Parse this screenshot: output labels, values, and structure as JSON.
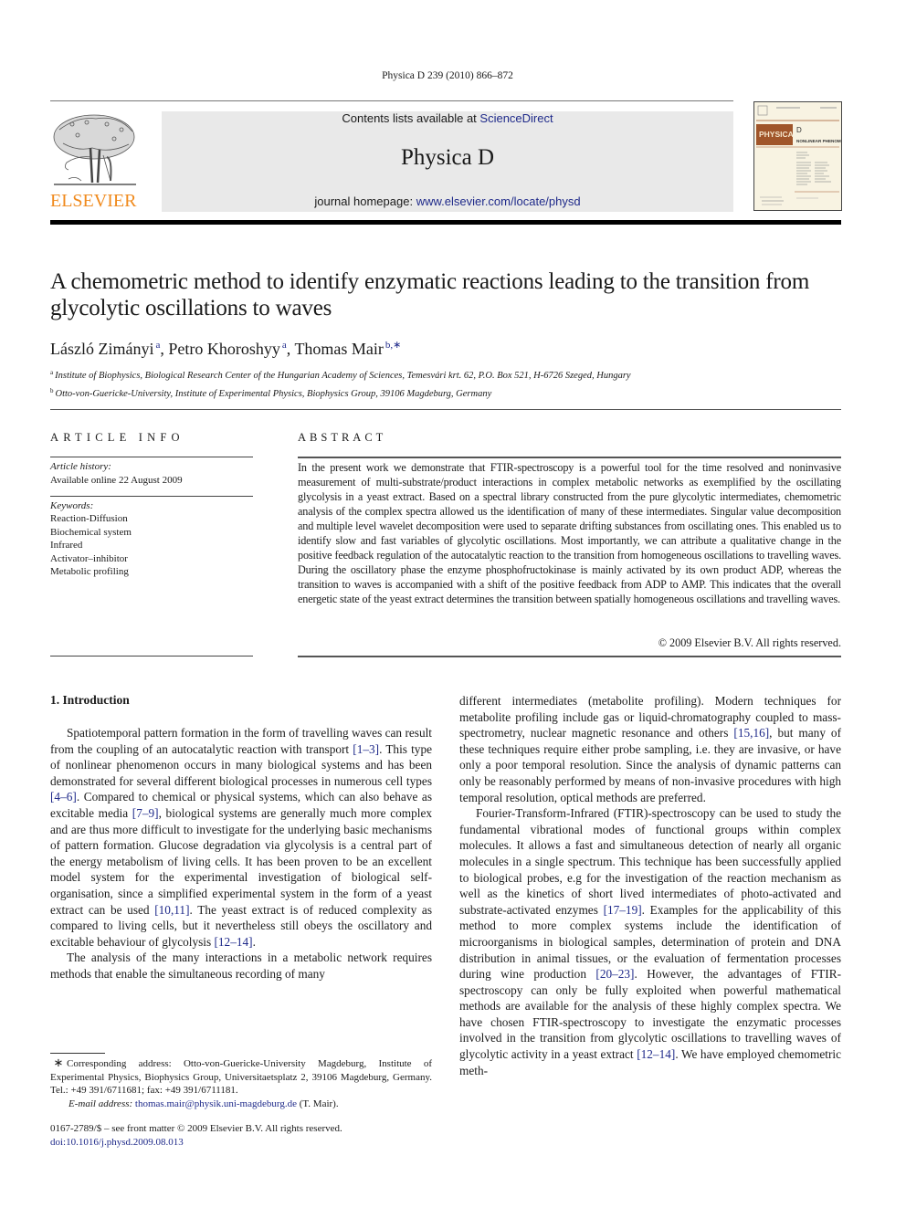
{
  "header": {
    "citation": "Physica D 239 (2010) 866–872",
    "publisher_logo_text": "ELSEVIER",
    "contents_prefix": "Contents lists available at ",
    "contents_link": "ScienceDirect",
    "journal_name": "Physica D",
    "homepage_prefix": "journal homepage: ",
    "homepage_link": "www.elsevier.com/locate/physd",
    "cover": {
      "brand": "PHYSICA",
      "letter": "D",
      "subtitle": "NONLINEAR PHENOMENA"
    },
    "colors": {
      "elsevier_orange": "#f08a1d",
      "link_blue": "#1f2a8a",
      "banner_gray": "#e9e9e9",
      "cover_brown": "#a0552a"
    }
  },
  "article": {
    "title": "A chemometric method to identify enzymatic reactions leading to the transition from glycolytic oscillations to waves",
    "authors": [
      {
        "name": "László Zimányi",
        "aff": "a"
      },
      {
        "name": "Petro Khoroshyy",
        "aff": "a"
      },
      {
        "name": "Thomas Mair",
        "aff": "b,∗"
      }
    ],
    "affiliations": [
      {
        "label": "a",
        "text": "Institute of Biophysics, Biological Research Center of the Hungarian Academy of Sciences, Temesvári krt. 62, P.O. Box 521, H-6726 Szeged, Hungary"
      },
      {
        "label": "b",
        "text": "Otto-von-Guericke-University, Institute of Experimental Physics, Biophysics Group, 39106 Magdeburg, Germany"
      }
    ]
  },
  "article_info": {
    "heading": "ARTICLE INFO",
    "history_label": "Article history:",
    "history_value": "Available online 22 August 2009",
    "keywords_label": "Keywords:",
    "keywords": [
      "Reaction-Diffusion",
      "Biochemical system",
      "Infrared",
      "Activator–inhibitor",
      "Metabolic profiling"
    ]
  },
  "abstract": {
    "heading": "ABSTRACT",
    "text": "In the present work we demonstrate that FTIR-spectroscopy is a powerful tool for the time resolved and noninvasive measurement of multi-substrate/product interactions in complex metabolic networks as exemplified by the oscillating glycolysis in a yeast extract. Based on a spectral library constructed from the pure glycolytic intermediates, chemometric analysis of the complex spectra allowed us the identification of many of these intermediates. Singular value decomposition and multiple level wavelet decomposition were used to separate drifting substances from oscillating ones. This enabled us to identify slow and fast variables of glycolytic oscillations. Most importantly, we can attribute a qualitative change in the positive feedback regulation of the autocatalytic reaction to the transition from homogeneous oscillations to travelling waves. During the oscillatory phase the enzyme phosphofructokinase is mainly activated by its own product ADP, whereas the transition to waves is accompanied with a shift of the positive feedback from ADP to AMP. This indicates that the overall energetic state of the yeast extract determines the transition between spatially homogeneous oscillations and travelling waves.",
    "copyright": "© 2009 Elsevier B.V. All rights reserved."
  },
  "body": {
    "section_title": "1.  Introduction",
    "left_paragraphs": [
      [
        {
          "t": "Spatiotemporal pattern formation in the form of travelling waves can result from the coupling of an autocatalytic reaction with transport "
        },
        {
          "ref": "[1–3]"
        },
        {
          "t": ". This type of nonlinear phenomenon occurs in many biological systems and has been demonstrated for several different biological processes in numerous cell types "
        },
        {
          "ref": "[4–6]"
        },
        {
          "t": ". Compared to chemical or physical systems, which can also behave as excitable media "
        },
        {
          "ref": "[7–9]"
        },
        {
          "t": ", biological systems are generally much more complex and are thus more difficult to investigate for the underlying basic mechanisms of pattern formation. Glucose degradation via glycolysis is a central part of the energy metabolism of living cells. It has been proven to be an excellent model system for the experimental investigation of biological self-organisation, since a simplified experimental system in the form of a yeast extract can be used "
        },
        {
          "ref": "[10,11]"
        },
        {
          "t": ". The yeast extract is of reduced complexity as compared to living cells, but it nevertheless still obeys the oscillatory and excitable behaviour of glycolysis "
        },
        {
          "ref": "[12–14]"
        },
        {
          "t": "."
        }
      ],
      [
        {
          "t": "The analysis of the many interactions in a metabolic network requires methods that enable the simultaneous recording of many"
        }
      ]
    ],
    "right_paragraphs": [
      [
        {
          "t": "different intermediates (metabolite profiling). Modern techniques for metabolite profiling include gas or liquid-chromatography coupled to mass-spectrometry, nuclear magnetic resonance and others "
        },
        {
          "ref": "[15,16]"
        },
        {
          "t": ", but many of these techniques require either probe sampling, i.e. they are invasive, or have only a poor temporal resolution. Since the analysis of dynamic patterns can only be reasonably performed by means of non-invasive procedures with high temporal resolution, optical methods are preferred."
        }
      ],
      [
        {
          "t": "Fourier-Transform-Infrared (FTIR)-spectroscopy can be used to study the fundamental vibrational modes of functional groups within complex molecules. It allows a fast and simultaneous detection of nearly all organic molecules in a single spectrum. This technique has been successfully applied to biological probes, e.g for the investigation of the reaction mechanism as well as the kinetics of short lived intermediates of photo-activated and substrate-activated enzymes "
        },
        {
          "ref": "[17–19]"
        },
        {
          "t": ". Examples for the applicability of this method to more complex systems include the identification of microorganisms in biological samples, determination of protein and DNA distribution in animal tissues, or the evaluation of fermentation processes during wine production "
        },
        {
          "ref": "[20–23]"
        },
        {
          "t": ". However, the advantages of FTIR-spectroscopy can only be fully exploited when powerful mathematical methods are available for the analysis of these highly complex spectra. We have chosen FTIR-spectroscopy to investigate the enzymatic processes involved in the transition from glycolytic oscillations to travelling waves of glycolytic activity in a yeast extract "
        },
        {
          "ref": "[12–14]"
        },
        {
          "t": ". We have employed chemometric meth-"
        }
      ]
    ]
  },
  "footnote": {
    "symbol": "∗",
    "address": "Corresponding address: Otto-von-Guericke-University Magdeburg, Institute of Experimental Physics, Biophysics Group, Universitaetsplatz 2, 39106 Magdeburg, Germany. Tel.: +49 391/6711681; fax: +49 391/6711181.",
    "email_label": "E-mail address:",
    "email": "thomas.mair@physik.uni-magdeburg.de",
    "email_suffix": " (T. Mair)."
  },
  "front_matter": {
    "issn_line": "0167-2789/$ – see front matter © 2009 Elsevier B.V. All rights reserved.",
    "doi": "doi:10.1016/j.physd.2009.08.013"
  }
}
